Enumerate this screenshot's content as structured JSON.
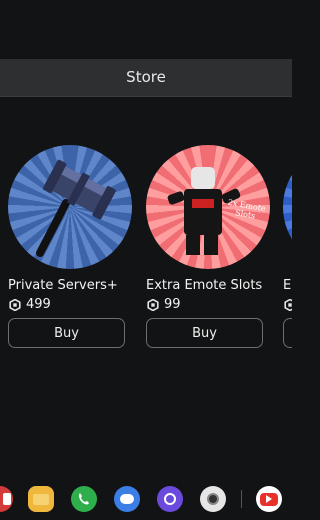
{
  "header": {
    "title": "Store"
  },
  "items": [
    {
      "name": "Private Servers+",
      "price": "499",
      "buy_label": "Buy",
      "icon": "hammer-icon"
    },
    {
      "name": "Extra Emote Slots",
      "price": "99",
      "buy_label": "Buy",
      "icon": "emote-avatar-icon",
      "badge_text": "2x Emote Slots"
    },
    {
      "name": "E",
      "price": "",
      "buy_label": ""
    }
  ],
  "currency_icon": "robux-icon",
  "dock": [
    {
      "name": "app-red-icon",
      "color": "#d33a3a"
    },
    {
      "name": "files-icon",
      "color": "#f0b73d"
    },
    {
      "name": "phone-icon",
      "color": "#2fae4c"
    },
    {
      "name": "messages-icon",
      "color": "#3a7ee6"
    },
    {
      "name": "internet-icon",
      "color": "#6a4bdd"
    },
    {
      "name": "camera-icon",
      "color": "#e6e6e6"
    },
    {
      "name": "youtube-icon",
      "color": "#e8312a"
    }
  ],
  "colors": {
    "background": "#121314",
    "header": "#2d2f30",
    "button_border": "#6c6e70"
  }
}
